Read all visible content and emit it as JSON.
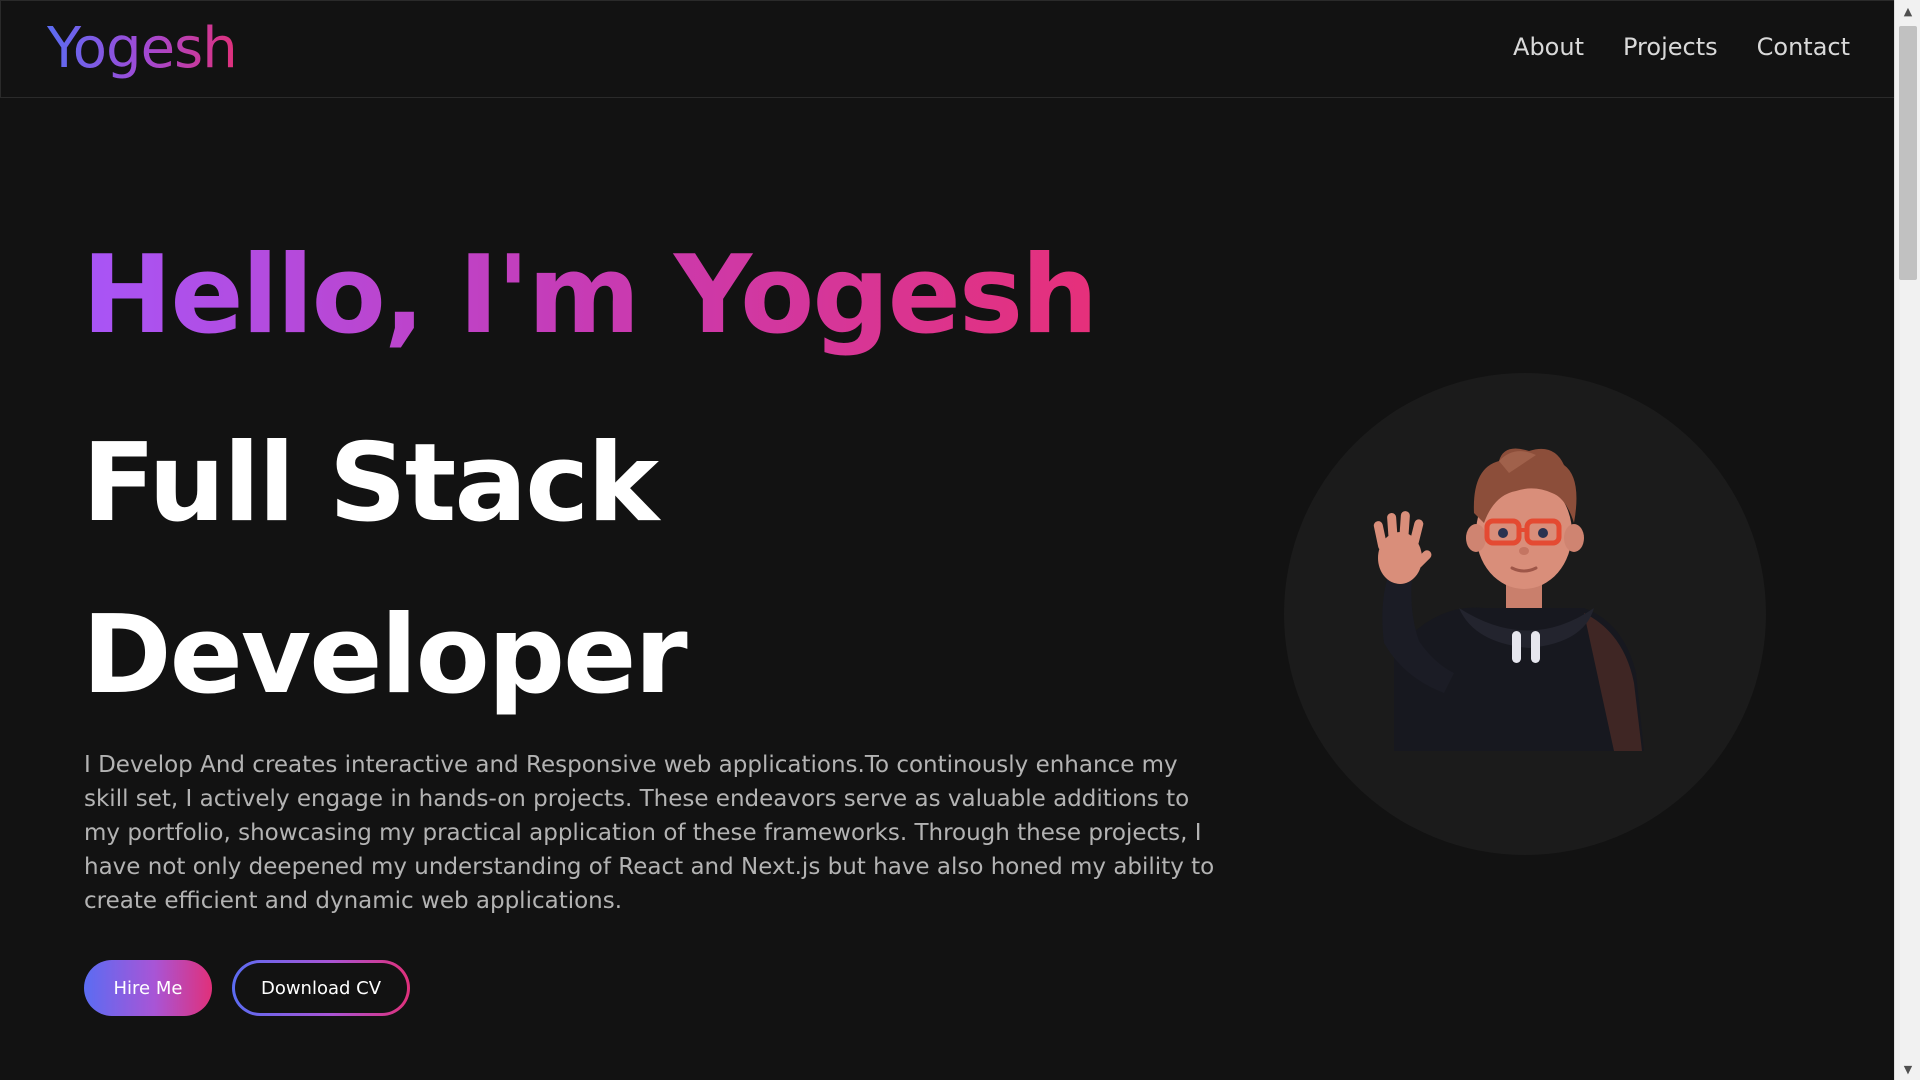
{
  "nav": {
    "logo": "Yogesh",
    "links": [
      "About",
      "Projects",
      "Contact"
    ]
  },
  "hero": {
    "title": "Hello, I'm Yogesh",
    "role_line1": "Full Stack",
    "role_line2": "Developer",
    "description": "I Develop And creates interactive and Responsive web applications.To continously enhance my skill set, I actively engage in hands-on projects. These endeavors serve as valuable additions to my portfolio, showcasing my practical application of these frameworks. Through these projects, I have not only deepened my understanding of React and Next.js but have also honed my ability to create efficient and dynamic web applications.",
    "hire_label": "Hire Me",
    "cv_label": "Download CV"
  },
  "avatar": {
    "icon": "waving-developer-avatar-icon"
  },
  "scrollbar": {
    "up_icon": "scroll-up-arrow-icon",
    "down_icon": "scroll-down-arrow-icon"
  },
  "colors": {
    "background": "#121212",
    "gradient_start": "#5b6cf2",
    "gradient_mid": "#a855f7",
    "gradient_end": "#e0307a",
    "text_muted": "#b3b3b3",
    "avatar_bg": "#1b1b1b"
  }
}
